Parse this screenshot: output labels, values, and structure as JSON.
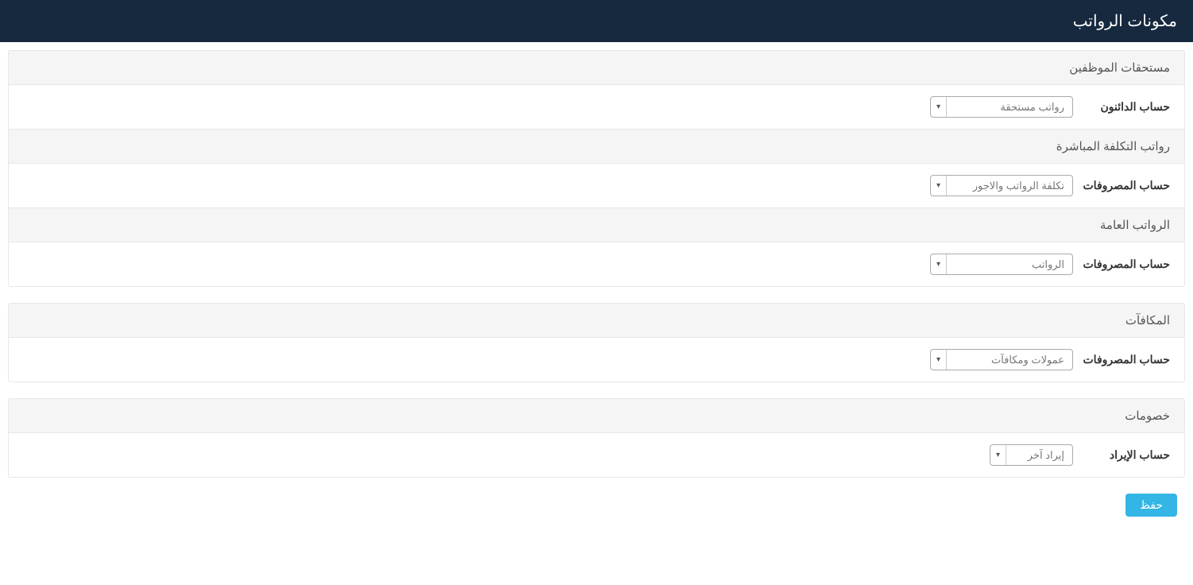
{
  "header": {
    "title": "مكونات الرواتب"
  },
  "panels": [
    {
      "sections": [
        {
          "title": "مستحقات الموظفين",
          "label": "حساب الدائنون",
          "value": "رواتب مستحقة"
        },
        {
          "title": "رواتب التكلفة المباشرة",
          "label": "حساب المصروفات",
          "value": "تكلفة الرواتب والاجور"
        },
        {
          "title": "الرواتب العامة",
          "label": "حساب المصروفات",
          "value": "الرواتب"
        }
      ]
    },
    {
      "sections": [
        {
          "title": "المكافآت",
          "label": "حساب المصروفات",
          "value": "عمولات ومكافآت"
        }
      ]
    },
    {
      "sections": [
        {
          "title": "خصومات",
          "label": "حساب الإيراد",
          "value": "إيراد آخر",
          "narrow": true
        }
      ]
    }
  ],
  "actions": {
    "save": "حفظ"
  }
}
